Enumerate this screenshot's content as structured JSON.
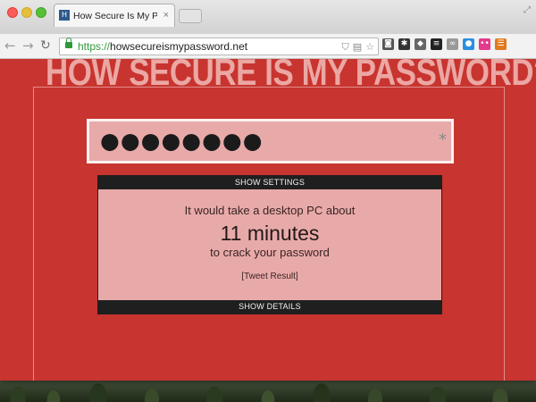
{
  "browser": {
    "tab_title": "How Secure Is My Password",
    "tab_close": "×",
    "favicon_text": "H",
    "url_scheme": "https://",
    "url_host": "howsecureismypassword.net",
    "nav": {
      "back": "←",
      "forward": "→",
      "reload": "↻"
    },
    "omnibox_icons": [
      "shield-icon",
      "reader-icon",
      "star-icon"
    ],
    "extension_icons": [
      {
        "name": "pocket-icon",
        "glyph": "◙",
        "color": "#555555"
      },
      {
        "name": "extension-icon",
        "glyph": "✱",
        "color": "#333333"
      },
      {
        "name": "tag-icon",
        "glyph": "◆",
        "color": "#666666"
      },
      {
        "name": "layers-icon",
        "glyph": "≡",
        "color": "#222222"
      },
      {
        "name": "infinity-icon",
        "glyph": "∞",
        "color": "#999999"
      },
      {
        "name": "chat-icon",
        "glyph": "●",
        "color": "#2a8fe0"
      },
      {
        "name": "flickr-icon",
        "glyph": "••",
        "color": "#e23a8c"
      },
      {
        "name": "menu-icon",
        "glyph": "☰",
        "color": "#e07a1f"
      }
    ]
  },
  "page": {
    "headline": "HOW SECURE IS MY PASSWORD?",
    "password_masked": "●●●●●●●●",
    "password_toggle": "*",
    "panel": {
      "settings_label": "SHOW SETTINGS",
      "result_pre": "It would take a desktop PC about",
      "result_time": "11 minutes",
      "result_post": "to crack your password",
      "tweet_label": "[Tweet Result]",
      "details_label": "SHOW DETAILS"
    }
  },
  "colors": {
    "page_bg": "#c8342f",
    "headline": "#eba7a3",
    "field_bg": "#e8aaa9",
    "bar_bg": "#1f1f1f"
  }
}
